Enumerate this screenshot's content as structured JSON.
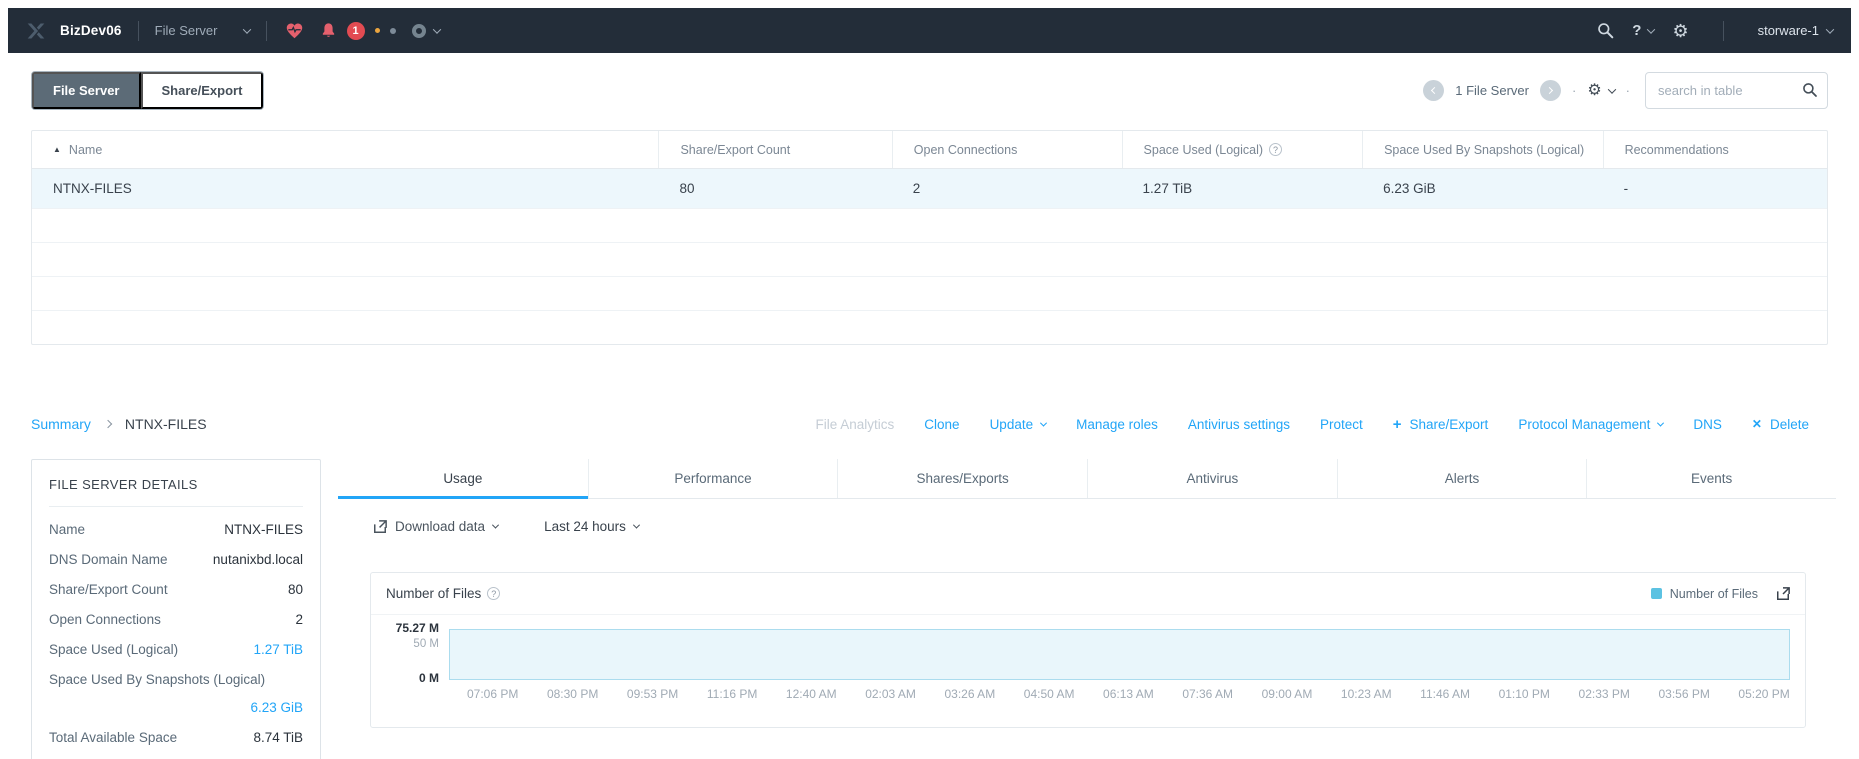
{
  "colors": {
    "accent_blue": "#22a5f7",
    "navbar_bg": "#232d39",
    "alert_red": "#e4606d",
    "badge_red": "#e24b52",
    "selected_row_bg": "#edf7fc",
    "chart_fill": "#e9f6fb",
    "chart_stroke": "#abdcee",
    "legend_swatch": "#5cc2e2"
  },
  "icons": {
    "sort_asc": "▲",
    "gear": "⚙",
    "plus": "+",
    "close": "✕",
    "help": "?",
    "dot_separator": "·"
  },
  "navbar": {
    "cluster": "BizDev06",
    "nav_item": "File Server",
    "alert_count": "1",
    "help_label": "?",
    "user": "storware-1"
  },
  "toolbar": {
    "tabs": [
      {
        "label": "File Server",
        "active": true
      },
      {
        "label": "Share/Export",
        "active": false
      }
    ],
    "count_label": "1 File Server",
    "search_placeholder": "search in table"
  },
  "table": {
    "sort": {
      "column": "Name",
      "direction": "asc"
    },
    "columns": [
      "Name",
      "Share/Export Count",
      "Open Connections",
      "Space Used (Logical)",
      "Space Used By Snapshots (Logical)",
      "Recommendations"
    ],
    "rows": [
      [
        "NTNX-FILES",
        "80",
        "2",
        "1.27 TiB",
        "6.23 GiB",
        "-"
      ]
    ],
    "empty_row_count": 4
  },
  "breadcrumb": {
    "parent": "Summary",
    "current": "NTNX-FILES"
  },
  "actions": [
    {
      "label": "File Analytics",
      "disabled": true
    },
    {
      "label": "Clone"
    },
    {
      "label": "Update",
      "dropdown": true
    },
    {
      "label": "Manage roles"
    },
    {
      "label": "Antivirus settings"
    },
    {
      "label": "Protect"
    },
    {
      "label": "Share/Export",
      "icon": "plus"
    },
    {
      "label": "Protocol Management",
      "dropdown": true
    },
    {
      "label": "DNS"
    },
    {
      "label": "Delete",
      "icon": "close"
    }
  ],
  "details": {
    "title": "FILE SERVER DETAILS",
    "rows": [
      {
        "label": "Name",
        "value": "NTNX-FILES"
      },
      {
        "label": "DNS Domain Name",
        "value": "nutanixbd.local"
      },
      {
        "label": "Share/Export Count",
        "value": "80"
      },
      {
        "label": "Open Connections",
        "value": "2"
      },
      {
        "label": "Space Used (Logical)",
        "value": "1.27 TiB",
        "link": true
      },
      {
        "label": "Space Used By Snapshots (Logical)",
        "value": "6.23 GiB",
        "link": true,
        "wrap": true
      },
      {
        "label": "Total Available Space",
        "value": "8.74 TiB"
      }
    ]
  },
  "detail_tabs": [
    "Usage",
    "Performance",
    "Shares/Exports",
    "Antivirus",
    "Alerts",
    "Events"
  ],
  "active_detail_tab": "Usage",
  "controls": {
    "download_label": "Download data",
    "range_label": "Last 24 hours"
  },
  "chart_data": {
    "type": "area",
    "title": "Number of Files",
    "legend": [
      "Number of Files"
    ],
    "legend_position": "top-right",
    "unit": "M (millions of files)",
    "ylim": [
      0,
      75.27
    ],
    "yticks": [
      "75.27 M",
      "50 M",
      "0 M"
    ],
    "grid": false,
    "x": [
      "07:06 PM",
      "08:30 PM",
      "09:53 PM",
      "11:16 PM",
      "12:40 AM",
      "02:03 AM",
      "03:26 AM",
      "04:50 AM",
      "06:13 AM",
      "07:36 AM",
      "09:00 AM",
      "10:23 AM",
      "11:46 AM",
      "01:10 PM",
      "02:33 PM",
      "03:56 PM",
      "05:20 PM"
    ],
    "series": [
      {
        "name": "Number of Files",
        "values": [
          75.27,
          75.27,
          75.27,
          75.27,
          75.27,
          75.27,
          75.27,
          75.27,
          75.27,
          75.27,
          75.27,
          75.27,
          75.27,
          75.27,
          75.27,
          75.27,
          75.27
        ]
      }
    ]
  }
}
